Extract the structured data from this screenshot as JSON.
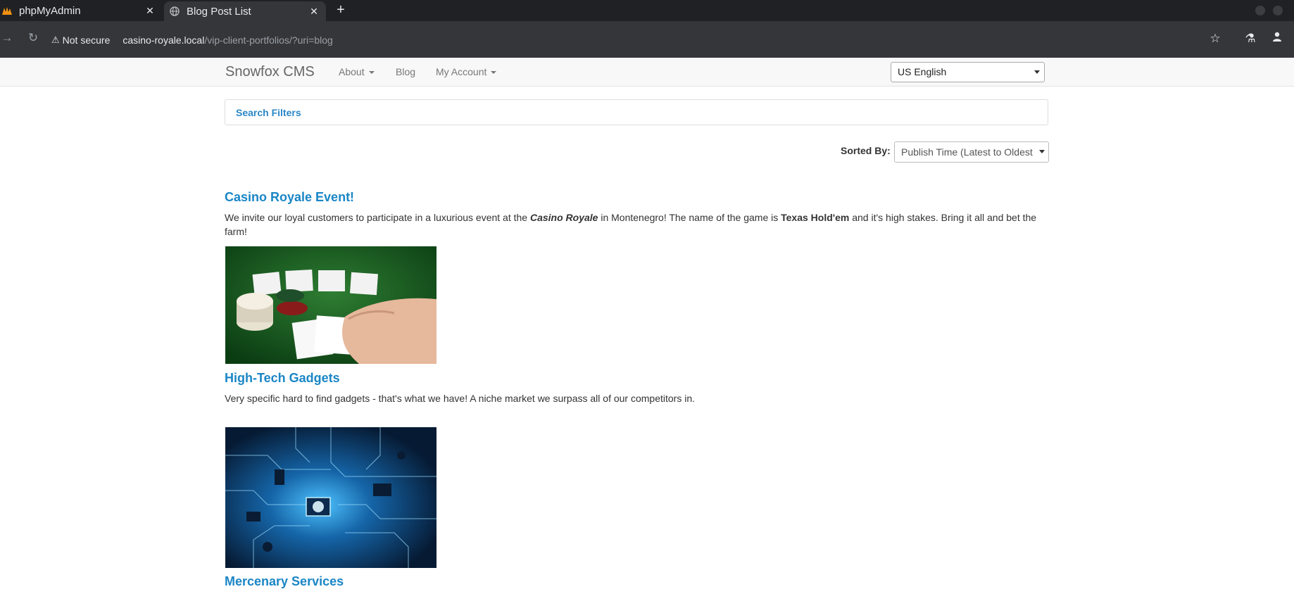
{
  "browser": {
    "tabs": [
      {
        "title": "phpMyAdmin",
        "close": "✕"
      },
      {
        "title": "Blog Post List",
        "close": "✕"
      }
    ],
    "new_tab": "+",
    "not_secure": "Not secure",
    "url_host": "casino-royale.local",
    "url_path": "/vip-client-portfolios/?uri=blog"
  },
  "navbar": {
    "brand": "Snowfox CMS",
    "items": [
      "About",
      "Blog",
      "My Account"
    ],
    "language": "US English"
  },
  "filters": {
    "label": "Search Filters"
  },
  "sort": {
    "label": "Sorted By:",
    "value": "Publish Time (Latest to Oldest"
  },
  "posts": [
    {
      "title": "Casino Royale Event!",
      "body_1": "We invite our loyal customers to participate in a luxurious event at the ",
      "body_em": "Casino Royale",
      "body_2": " in Montenegro! The name of the game is ",
      "body_strong": "Texas Hold'em",
      "body_3": " and it's high stakes. Bring it all and bet the farm!"
    },
    {
      "title": "High-Tech Gadgets",
      "body": "Very specific hard to find gadgets - that's what we have! A niche market we surpass all of our competitors in."
    },
    {
      "title": "Mercenary Services"
    }
  ],
  "colors": {
    "link": "#1a86c6",
    "chrome_dark": "#202124",
    "chrome_mid": "#35363a"
  }
}
